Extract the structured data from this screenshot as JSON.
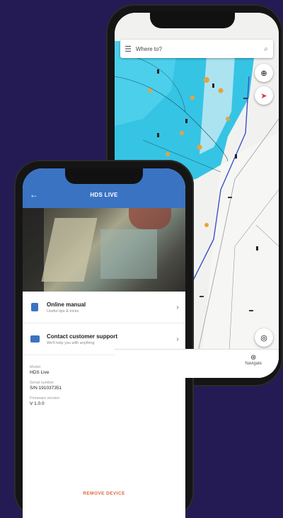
{
  "back_phone": {
    "search_placeholder": "Where to?",
    "nav_tab_label": "Navigate",
    "icons": {
      "menu": "menu-icon",
      "search": "search-icon",
      "compass": "compass-icon",
      "layers": "layers-icon",
      "locate": "locate-icon",
      "navigate": "navigate-icon"
    }
  },
  "front_phone": {
    "appbar_title": "HDS LIVE",
    "actions": [
      {
        "title": "Online manual",
        "subtitle": "Useful tips & tricks"
      },
      {
        "title": "Contact customer support",
        "subtitle": "We'll help you with anything"
      }
    ],
    "device_info": [
      {
        "label": "Model",
        "value": "HDS Live"
      },
      {
        "label": "Serial number",
        "value": "S/N 191037351"
      },
      {
        "label": "Firmware version",
        "value": "V 1.0.0"
      }
    ],
    "remove_label": "REMOVE DEVICE"
  },
  "colors": {
    "background": "#241b55",
    "appbar": "#3b73c3",
    "remove": "#e0643a",
    "water": "#35c6e6"
  }
}
